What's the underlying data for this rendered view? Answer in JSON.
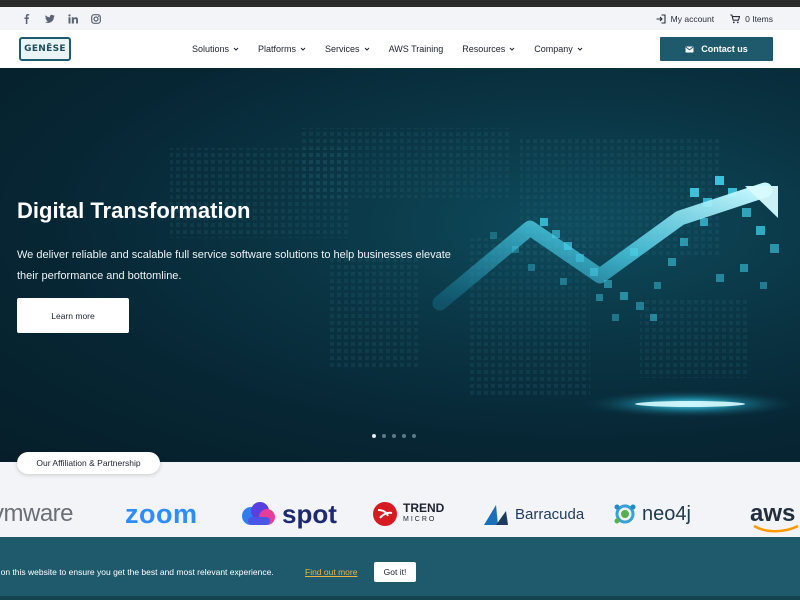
{
  "topbar": {
    "socials": [
      "facebook-icon",
      "twitter-icon",
      "linkedin-icon",
      "instagram-icon"
    ],
    "account_label": "My account",
    "cart_label": "0 Items"
  },
  "header": {
    "logo_text": "GENĒSE",
    "nav": [
      {
        "label": "Solutions",
        "dropdown": true
      },
      {
        "label": "Platforms",
        "dropdown": true
      },
      {
        "label": "Services",
        "dropdown": true
      },
      {
        "label": "AWS Training",
        "dropdown": false
      },
      {
        "label": "Resources",
        "dropdown": true
      },
      {
        "label": "Company",
        "dropdown": true
      }
    ],
    "contact_label": "Contact us"
  },
  "hero": {
    "title": "Digital Transformation",
    "text": "We deliver reliable and scalable  full service software solutions to help  businesses elevate their performance and bottomline.",
    "button_label": "Learn more",
    "slide_count": 5,
    "active_slide": 1
  },
  "partners": {
    "heading": "Our Affiliation & Partnership",
    "logos": {
      "vmware": "vmware",
      "zoom": "zoom",
      "spot": "spot",
      "trend": "TREND",
      "trend_sub": "MICRO",
      "barracuda": "Barracuda",
      "neo4j": "neo4j",
      "aws": "aws"
    }
  },
  "cookie": {
    "text": "s on this website to ensure you get the best and most relevant experience.",
    "link_label": "Find out more",
    "button_label": "Got it!"
  },
  "colors": {
    "brand": "#1e5a6c",
    "link": "#f0b340",
    "zoom": "#2d8cff",
    "trend_red": "#d71920"
  }
}
